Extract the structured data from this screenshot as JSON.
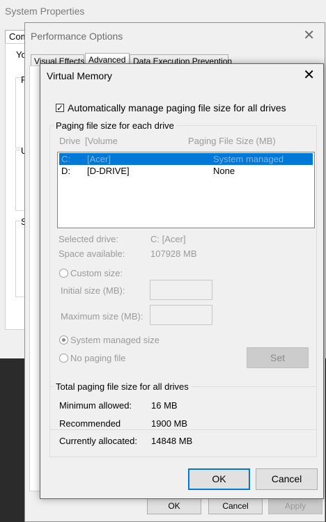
{
  "system_properties": {
    "title": "System Properties",
    "tab_fragment": "Computer Name",
    "fragments": [
      "Yo",
      "P",
      "U",
      "S"
    ]
  },
  "performance_options": {
    "title": "Performance Options",
    "tabs": [
      {
        "label": "Visual Effects"
      },
      {
        "label": "Advanced",
        "active": true
      },
      {
        "label": "Data Execution Prevention"
      }
    ],
    "buttons": {
      "ok": "OK",
      "cancel": "Cancel",
      "apply": "Apply"
    }
  },
  "virtual_memory": {
    "title": "Virtual Memory",
    "auto_manage": {
      "label": "Automatically manage paging file size for all drives",
      "checked": true
    },
    "paging_group": {
      "label": "Paging file size for each drive",
      "columns": {
        "drive": "Drive",
        "volume": "[Volume",
        "size": "Paging File Size (MB)"
      },
      "rows": [
        {
          "drive": "C:",
          "volume": "[Acer]",
          "size": "System managed",
          "selected": true
        },
        {
          "drive": "D:",
          "volume": "[D-DRIVE]",
          "size": "None",
          "selected": false
        }
      ],
      "selected_drive_label": "Selected drive:",
      "selected_drive_value": "C:  [Acer]",
      "space_label": "Space available:",
      "space_value": "107928 MB",
      "custom_size": "Custom size:",
      "initial_size": "Initial size (MB):",
      "maximum_size": "Maximum size (MB):",
      "system_managed": "System managed size",
      "no_paging": "No paging file",
      "selected_option": "system_managed",
      "set_button": "Set"
    },
    "total_group": {
      "label": "Total paging file size for all drives",
      "min_label": "Minimum allowed:",
      "min_value": "16 MB",
      "rec_label": "Recommended",
      "rec_value": "1900 MB",
      "cur_label": "Currently allocated:",
      "cur_value": "14848 MB"
    },
    "ok_button": "OK",
    "cancel_button": "Cancel"
  },
  "colors": {
    "accent": "#0078d7",
    "dialog_bg": "#f0f0f0"
  }
}
